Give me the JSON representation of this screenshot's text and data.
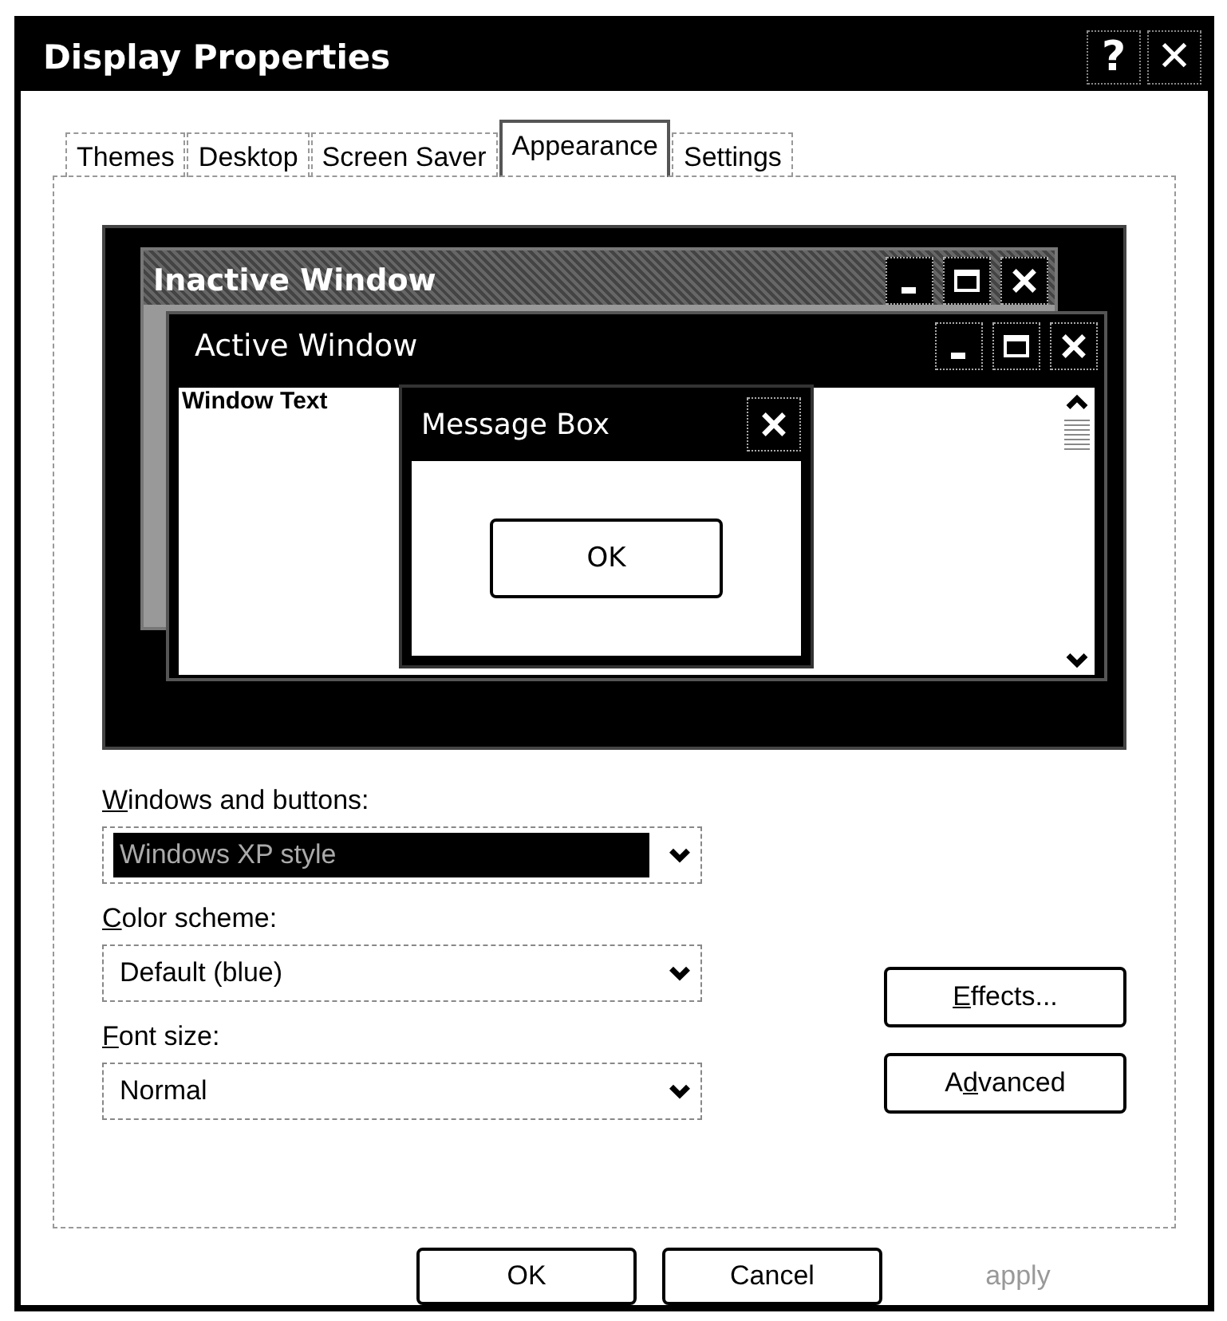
{
  "window": {
    "title": "Display Properties",
    "help_button": "?",
    "close_button": "✕"
  },
  "tabs": [
    {
      "label": "Themes",
      "selected": false
    },
    {
      "label": "Desktop",
      "selected": false
    },
    {
      "label": "Screen Saver",
      "selected": false
    },
    {
      "label": "Appearance",
      "selected": true
    },
    {
      "label": "Settings",
      "selected": false
    }
  ],
  "preview": {
    "inactive_window": {
      "title": "Inactive Window"
    },
    "active_window": {
      "title": "Active Window",
      "text": "Window Text"
    },
    "message_box": {
      "title": "Message Box",
      "button": "OK"
    }
  },
  "fields": [
    {
      "label": {
        "key": "W",
        "rest": "indows and buttons:"
      },
      "value": "Windows XP style",
      "selected": true
    },
    {
      "label": {
        "key": "C",
        "rest": "olor scheme:"
      },
      "value": "Default (blue)",
      "selected": false
    },
    {
      "label": {
        "key": "F",
        "rest": "ont size:"
      },
      "value": "Normal",
      "selected": false
    }
  ],
  "side_buttons": [
    {
      "parts": [
        {
          "text": "E",
          "underlined": true
        },
        {
          "text": "ffects...",
          "underlined": false
        }
      ]
    },
    {
      "parts": [
        {
          "text": "A",
          "underlined": false
        },
        {
          "text": "d",
          "underlined": true
        },
        {
          "text": "vanced",
          "underlined": false
        }
      ]
    }
  ],
  "buttons": [
    {
      "label": "OK",
      "disabled": false
    },
    {
      "label": "Cancel",
      "disabled": false
    },
    {
      "label": "apply",
      "disabled": true
    }
  ]
}
